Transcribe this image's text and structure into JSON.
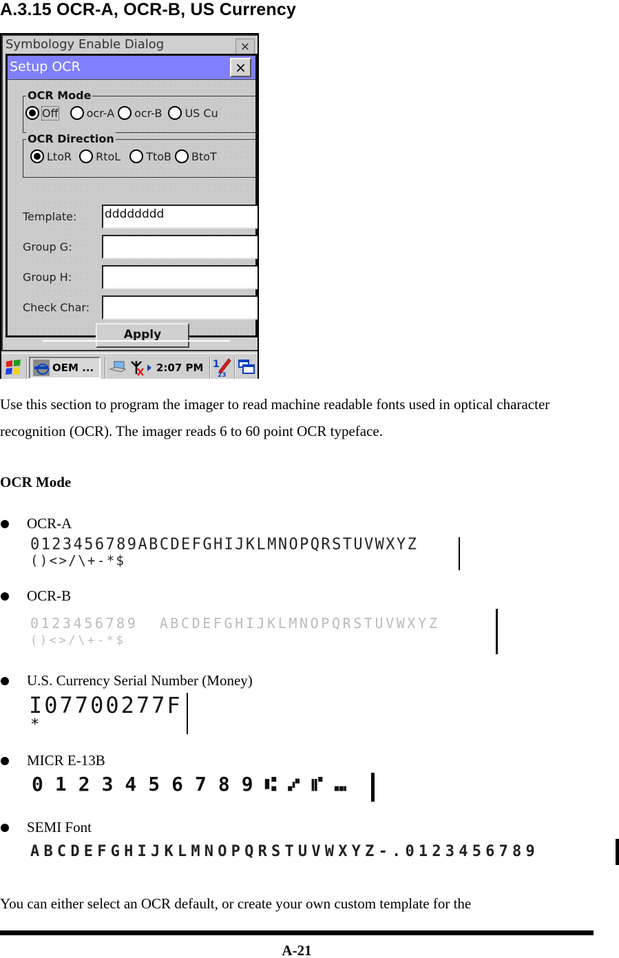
{
  "section_title": "A.3.15 OCR-A, OCR-B, US Currency",
  "screenshot": {
    "background_window_title": "Symbology Enable Dialog",
    "background_close_label": "×",
    "dialog": {
      "title": "Setup OCR",
      "close_label": "×",
      "title_bar_color": "#8080ff",
      "ocr_mode": {
        "legend": "OCR Mode",
        "options": [
          {
            "label": "Off",
            "selected": true
          },
          {
            "label": "ocr-A",
            "selected": false
          },
          {
            "label": "ocr-B",
            "selected": false
          },
          {
            "label": "US Cu",
            "selected": false
          }
        ]
      },
      "ocr_direction": {
        "legend": "OCR Direction",
        "options": [
          {
            "label": "LtoR",
            "selected": true
          },
          {
            "label": "RtoL",
            "selected": false
          },
          {
            "label": "TtoB",
            "selected": false
          },
          {
            "label": "BtoT",
            "selected": false
          }
        ]
      },
      "fields": [
        {
          "label": "Template:",
          "value": "dddddddd"
        },
        {
          "label": "Group G:",
          "value": ""
        },
        {
          "label": "Group H:",
          "value": ""
        },
        {
          "label": "Check Char:",
          "value": ""
        }
      ],
      "apply_label": "Apply"
    },
    "taskbar": {
      "start_icon": "windows-start-icon",
      "task_label": "OEM ...",
      "clock": "2:07 PM",
      "tray_icons": [
        "network-icon",
        "antenna-disconnected-icon",
        "input-panel-icon",
        "desktop-icon"
      ]
    }
  },
  "intro_paragraph": "Use this section to program the imager to read machine readable fonts used in optical character recognition (OCR). The imager reads 6 to 60 point OCR typeface.",
  "ocr_mode_heading": "OCR Mode",
  "fonts": [
    {
      "name": "OCR-A",
      "sample_lines": [
        "0123456789ABCDEFGHIJKLMNOPQRSTUVWXYZ",
        "()<>/\\+-*$"
      ]
    },
    {
      "name": "OCR-B",
      "sample_lines": [
        "0123456789  ABCDEFGHIJKLMNOPQRSTUVWXYZ",
        "()<>/\\+-*$"
      ]
    },
    {
      "name": "U.S. Currency Serial Number (Money)",
      "sample_lines": [
        "I07700277F",
        "*"
      ]
    },
    {
      "name": "MICR E-13B",
      "sample_lines": [
        "0123456789⑆⑇⑈⑉"
      ]
    },
    {
      "name": "SEMI Font",
      "sample_lines": [
        "ABCDEFGHIJKLMNOPQRSTUVWXYZ-.0123456789"
      ]
    }
  ],
  "closing_paragraph": "You can either select an OCR default, or create your own custom template for the",
  "page_number": "A-21"
}
